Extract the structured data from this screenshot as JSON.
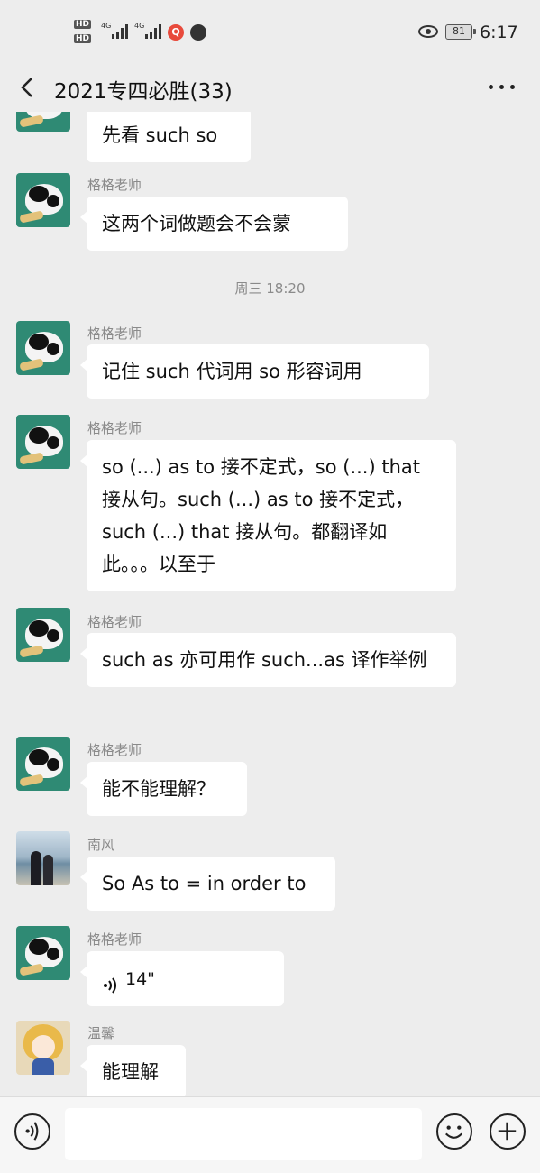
{
  "status_bar": {
    "hd_top": "HD",
    "hd_bottom": "HD",
    "sig1": "4G",
    "sig2": "4G",
    "battery": "81",
    "time": "6:17"
  },
  "header": {
    "title": "2021专四必胜(33)"
  },
  "timestamp": "周三 18:20",
  "messages": [
    {
      "sender": "",
      "text": "先看 such  so"
    },
    {
      "sender": "格格老师",
      "text": "这两个词做题会不会蒙"
    },
    {
      "sender": "格格老师",
      "text": "记住 such 代词用   so 形容词用"
    },
    {
      "sender": "格格老师",
      "text": "so (...) as to 接不定式，so (...) that 接从句。such (...) as to 接不定式，such (...) that 接从句。都翻译如此。。。以至于"
    },
    {
      "sender": "格格老师",
      "text": "such as 亦可用作 such...as  译作举例"
    },
    {
      "sender": "格格老师",
      "text": "能不能理解？"
    },
    {
      "sender": "南风",
      "text": "So As to  = in order to"
    },
    {
      "sender": "格格老师",
      "text": "14\"",
      "type": "voice"
    },
    {
      "sender": "温馨",
      "text": "能理解"
    }
  ],
  "input": {
    "placeholder": ""
  },
  "icons": {
    "back": "chevron-left-icon",
    "more": "more-dots-icon",
    "voice_input": "voice-icon",
    "emoji": "emoji-icon",
    "add": "plus-icon"
  }
}
